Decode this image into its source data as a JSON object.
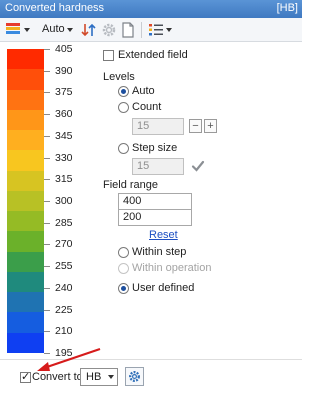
{
  "window": {
    "title": "Converted hardness",
    "unit_badge": "[HB]"
  },
  "toolbar": {
    "mode_label": "Auto",
    "icons": [
      "color-palette-icon",
      "sort-order-icon",
      "settings-gear-icon",
      "document-icon",
      "legend-list-icon"
    ]
  },
  "scale": {
    "labels": [
      "405",
      "390",
      "375",
      "360",
      "345",
      "330",
      "315",
      "300",
      "285",
      "270",
      "255",
      "240",
      "225",
      "210",
      "195"
    ],
    "colors": [
      "#ff2a00",
      "#ff4f0a",
      "#ff7312",
      "#ff9618",
      "#ffaf1f",
      "#f8c61f",
      "#d7c422",
      "#b8c125",
      "#95bb25",
      "#6bb12a",
      "#3b9e4a",
      "#1f8a7d",
      "#1f73b2",
      "#155de0",
      "#0f3ff2"
    ]
  },
  "panel": {
    "extended_field_label": "Extended field",
    "extended_field_checked": false,
    "levels_heading": "Levels",
    "auto_label": "Auto",
    "count_label": "Count",
    "count_value": "15",
    "step_size_label": "Step size",
    "step_size_value": "15",
    "field_range_heading": "Field range",
    "range_max": "400",
    "range_min": "200",
    "reset_label": "Reset",
    "within_step_label": "Within step",
    "within_operation_label": "Within operation",
    "user_defined_label": "User defined",
    "selected_level_mode": "auto",
    "selected_range_mode": "user_defined"
  },
  "bottom": {
    "convert_to_label": "Convert to",
    "convert_to_checked": true,
    "unit_value": "HB"
  }
}
